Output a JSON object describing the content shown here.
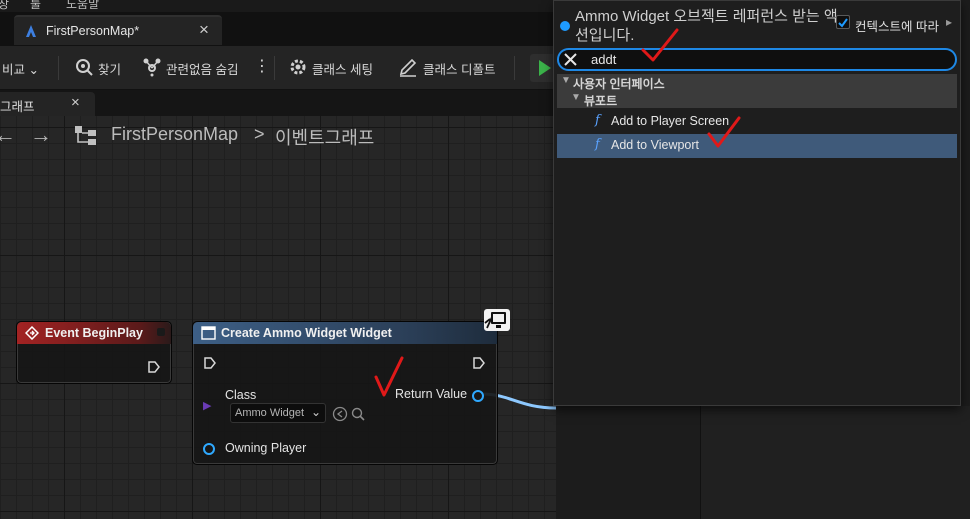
{
  "menubar": {
    "items": [
      "창",
      "툴",
      "도움말"
    ]
  },
  "document_tab": {
    "title": "FirstPersonMap*",
    "close": "×"
  },
  "toolbar": {
    "diff": "비교",
    "find": "찾기",
    "hide_unrelated": "관련없음 숨김",
    "class_settings": "클래스 세팅",
    "class_defaults": "클래스 디폴트"
  },
  "graph_tab": {
    "label": "그래프",
    "close": "×"
  },
  "breadcrumb": {
    "map": "FirstPersonMap",
    "sep": ">",
    "graph": "이벤트그래프"
  },
  "nodes": {
    "begin_play": {
      "title": "Event BeginPlay"
    },
    "create_widget": {
      "title": "Create Ammo Widget Widget",
      "class_label": "Class",
      "class_value": "Ammo Widget",
      "return_value": "Return Value",
      "owning_player": "Owning Player"
    }
  },
  "popup": {
    "title": "Ammo Widget 오브젝트 레퍼런스 받는 액션입니다.",
    "context_label": "컨텍스트에 따라",
    "context_checked": true,
    "search_value": "addt",
    "category": "사용자 인터페이스",
    "subcategory": "뷰포트",
    "items": [
      "Add to Player Screen",
      "Add to Viewport"
    ],
    "selected_index": 1
  },
  "colors": {
    "accent": "#1e88e5",
    "event_header": "#9a1d1d",
    "function_header": "#3d5f86",
    "selected_row": "#3f5a7a",
    "checkmark": "#e01919",
    "wire": "#8ec9ff"
  }
}
